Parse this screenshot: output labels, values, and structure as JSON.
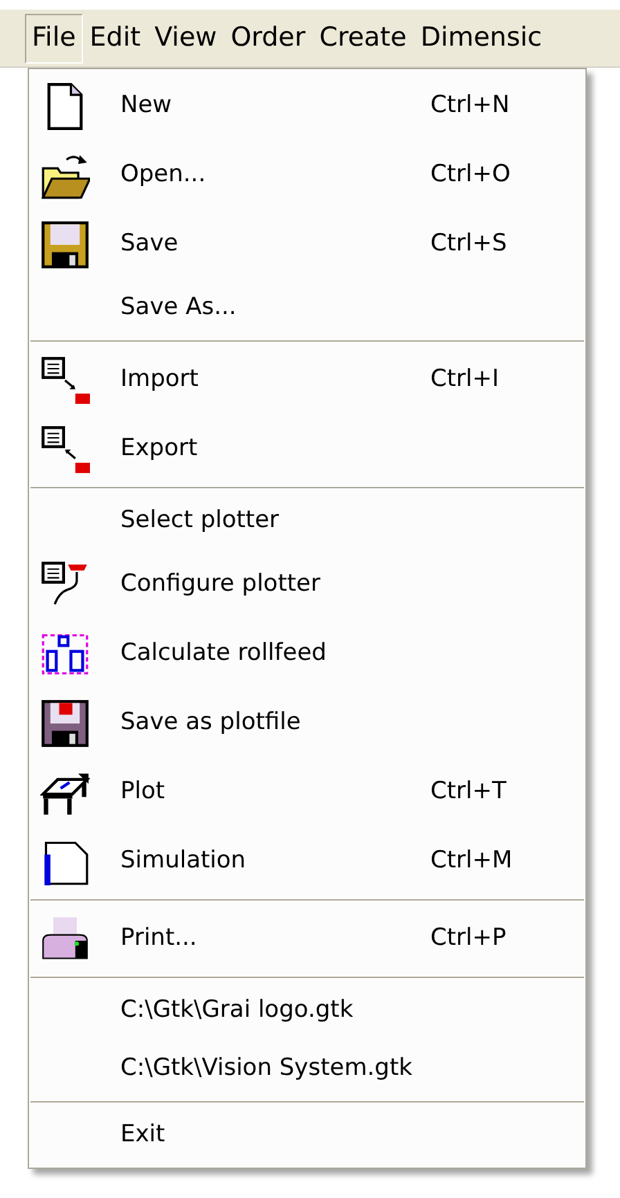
{
  "menubar": [
    {
      "label": "File",
      "selected": true
    },
    {
      "label": "Edit",
      "selected": false
    },
    {
      "label": "View",
      "selected": false
    },
    {
      "label": "Order",
      "selected": false
    },
    {
      "label": "Create",
      "selected": false
    },
    {
      "label": "Dimensic",
      "selected": false
    }
  ],
  "file_menu": [
    {
      "kind": "item",
      "label": "New",
      "shortcut": "Ctrl+N"
    },
    {
      "kind": "item",
      "label": "Open...",
      "shortcut": "Ctrl+O"
    },
    {
      "kind": "item",
      "label": "Save",
      "shortcut": "Ctrl+S"
    },
    {
      "kind": "item",
      "label": "Save As..."
    },
    {
      "kind": "separator"
    },
    {
      "kind": "item",
      "label": "Import",
      "shortcut": "Ctrl+I"
    },
    {
      "kind": "item",
      "label": "Export"
    },
    {
      "kind": "separator"
    },
    {
      "kind": "item",
      "label": "Select plotter"
    },
    {
      "kind": "item",
      "label": "Configure plotter"
    },
    {
      "kind": "item",
      "label": "Calculate rollfeed"
    },
    {
      "kind": "item",
      "label": "Save as plotfile"
    },
    {
      "kind": "item",
      "label": "Plot",
      "shortcut": "Ctrl+T"
    },
    {
      "kind": "item",
      "label": "Simulation",
      "shortcut": "Ctrl+M"
    },
    {
      "kind": "separator"
    },
    {
      "kind": "item",
      "label": "Print...",
      "shortcut": "Ctrl+P"
    },
    {
      "kind": "separator"
    },
    {
      "kind": "item",
      "label": "C:\\Gtk\\Grai logo.gtk"
    },
    {
      "kind": "item",
      "label": "C:\\Gtk\\Vision System.gtk"
    },
    {
      "kind": "separator"
    },
    {
      "kind": "item",
      "label": "Exit"
    }
  ]
}
